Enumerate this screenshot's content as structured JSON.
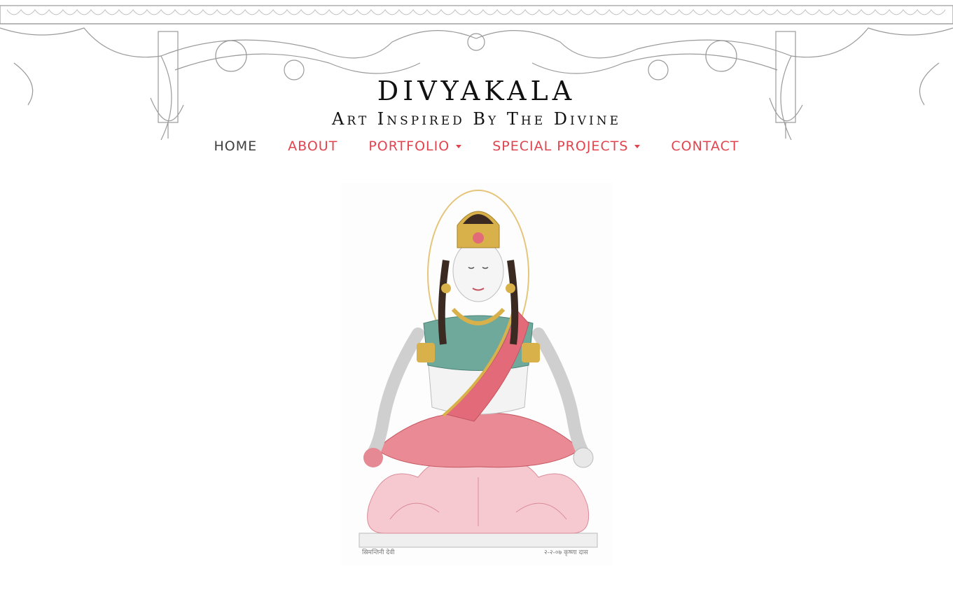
{
  "brand": {
    "title": "DIVYAKALA",
    "tagline": "Art Inspired By The Divine"
  },
  "nav": {
    "home": "HOME",
    "about": "ABOUT",
    "portfolio": "PORTFOLIO",
    "special_projects": "SPECIAL PROJECTS",
    "contact": "CONTACT"
  },
  "colors": {
    "nav_link": "#e0444e",
    "nav_active": "#3f3f3f"
  },
  "artwork": {
    "signature_left": "स्रिमन्तिनी देवी",
    "signature_right": "२-२-०७ कृष्णा दास"
  }
}
